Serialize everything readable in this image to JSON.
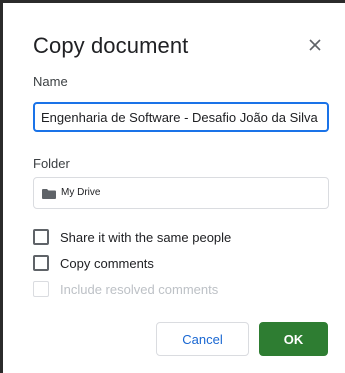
{
  "dialog": {
    "title": "Copy document",
    "close_icon": "close-icon"
  },
  "name": {
    "label": "Name",
    "value": "Engenharia de Software - Desafio João da Silva"
  },
  "folder": {
    "label": "Folder",
    "value": "My Drive",
    "icon": "folder-icon"
  },
  "options": {
    "share": {
      "label": "Share it with the same people",
      "checked": false
    },
    "copy_comments": {
      "label": "Copy comments",
      "checked": false
    },
    "include_resolved": {
      "label": "Include resolved comments",
      "checked": false,
      "disabled": true
    }
  },
  "buttons": {
    "cancel": "Cancel",
    "ok": "OK"
  },
  "colors": {
    "accent_blue": "#1a73e8",
    "ok_green": "#2e7d32"
  }
}
